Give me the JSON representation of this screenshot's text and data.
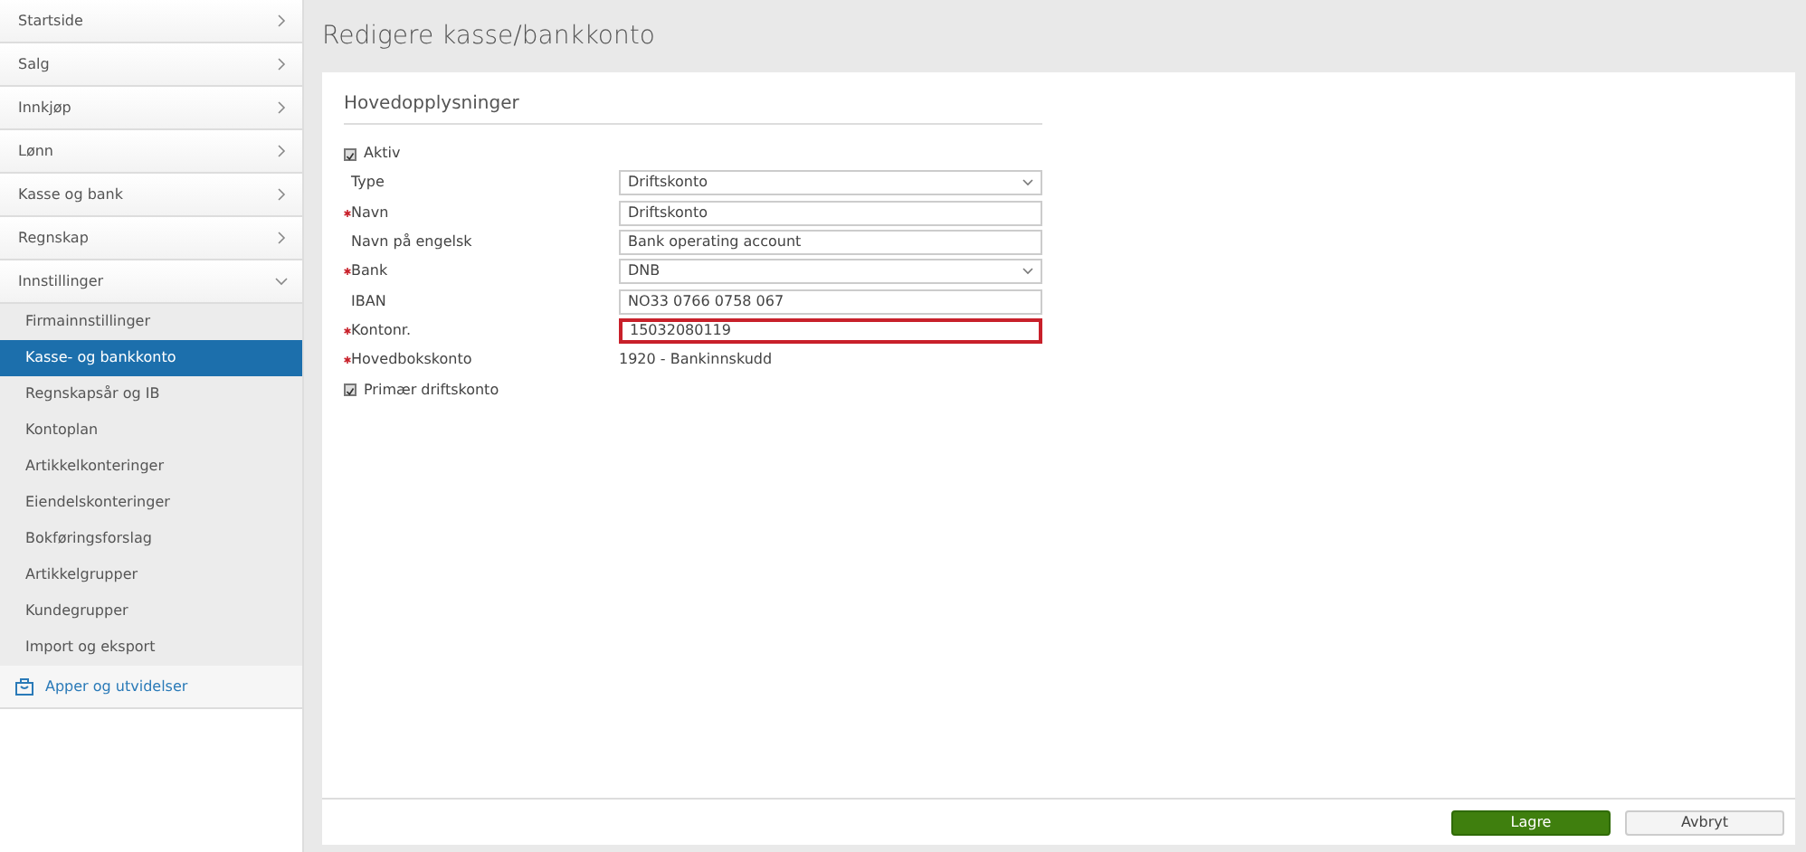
{
  "sidebar": {
    "items": [
      {
        "label": "Startside",
        "expanded": false
      },
      {
        "label": "Salg",
        "expanded": false
      },
      {
        "label": "Innkjøp",
        "expanded": false
      },
      {
        "label": "Lønn",
        "expanded": false
      },
      {
        "label": "Kasse og bank",
        "expanded": false
      },
      {
        "label": "Regnskap",
        "expanded": false
      },
      {
        "label": "Innstillinger",
        "expanded": true,
        "children": [
          {
            "label": "Firmainnstillinger",
            "selected": false
          },
          {
            "label": "Kasse- og bankkonto",
            "selected": true
          },
          {
            "label": "Regnskapsår og IB",
            "selected": false
          },
          {
            "label": "Kontoplan",
            "selected": false
          },
          {
            "label": "Artikkelkonteringer",
            "selected": false
          },
          {
            "label": "Eiendelskonteringer",
            "selected": false
          },
          {
            "label": "Bokføringsforslag",
            "selected": false
          },
          {
            "label": "Artikkelgrupper",
            "selected": false
          },
          {
            "label": "Kundegrupper",
            "selected": false
          },
          {
            "label": "Import og eksport",
            "selected": false
          }
        ]
      }
    ],
    "apps_link": "Apper og utvidelser"
  },
  "page_title": "Redigere kasse/bankkonto",
  "section_title": "Hovedopplysninger",
  "fields": [
    {
      "kind": "checkbox",
      "label": "Aktiv",
      "checked": true
    },
    {
      "kind": "select",
      "label": "Type",
      "required": false,
      "value": "Driftskonto"
    },
    {
      "kind": "input",
      "label": "Navn",
      "required": true,
      "value": "Driftskonto"
    },
    {
      "kind": "input",
      "label": "Navn på engelsk",
      "required": false,
      "value": "Bank operating account"
    },
    {
      "kind": "select",
      "label": "Bank",
      "required": true,
      "value": "DNB"
    },
    {
      "kind": "input",
      "label": "IBAN",
      "required": false,
      "value": "NO33 0766 0758 067"
    },
    {
      "kind": "input",
      "label": "Kontonr.",
      "required": true,
      "value": "15032080119",
      "highlighted": true
    },
    {
      "kind": "text",
      "label": "Hovedbokskonto",
      "required": true,
      "value": "1920 - Bankinnskudd"
    },
    {
      "kind": "checkbox",
      "label": "Primær driftskonto",
      "checked": true
    }
  ],
  "buttons": {
    "save": "Lagre",
    "cancel": "Avbryt"
  }
}
